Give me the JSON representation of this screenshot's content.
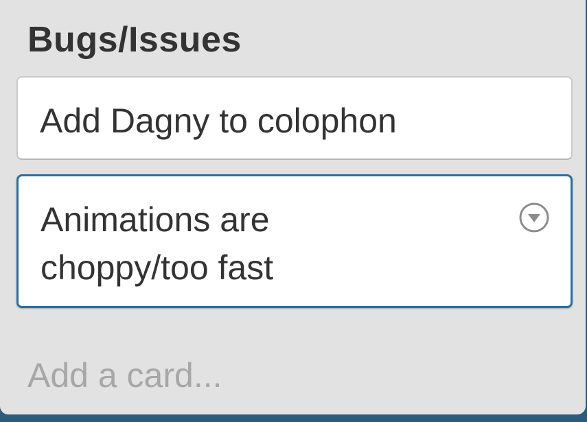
{
  "list": {
    "title": "Bugs/Issues",
    "cards": [
      {
        "text": "Add Dagny to colophon"
      },
      {
        "text": "Animations are choppy/too fast",
        "menu_icon": "chevron-down-circle-icon"
      }
    ],
    "add_card_label": "Add a card..."
  },
  "colors": {
    "board_background": "#2b5b7d",
    "list_background": "#e2e2e2",
    "card_background": "#ffffff",
    "selected_card_border": "#2a6fa0",
    "add_card_text": "#a7a7a7"
  }
}
